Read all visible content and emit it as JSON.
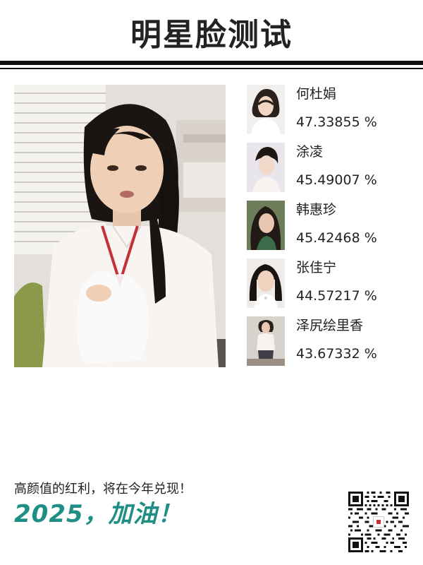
{
  "header": {
    "title": "明星脸测试"
  },
  "main_photo": {
    "alt": "uploaded face photo"
  },
  "matches": [
    {
      "name": "何杜娟",
      "score": "47.33855 %"
    },
    {
      "name": "涂凌",
      "score": "45.49007 %"
    },
    {
      "name": "韩惠珍",
      "score": "45.42468 %"
    },
    {
      "name": "张佳宁",
      "score": "44.57217 %"
    },
    {
      "name": "泽尻绘里香",
      "score": "43.67332 %"
    }
  ],
  "footer": {
    "tagline": "高颜值的红利，将在今年兑现！",
    "slogan": "2025，加油！"
  },
  "colors": {
    "accent": "#1f8f86",
    "rule": "#111111",
    "text": "#222222"
  }
}
